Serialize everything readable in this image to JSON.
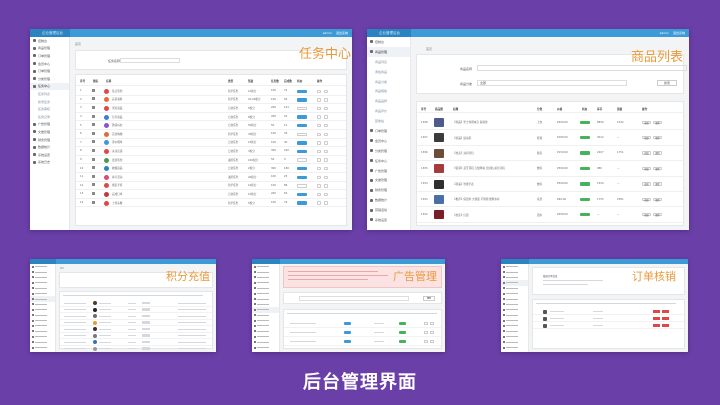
{
  "caption": "后台管理界面",
  "admin": {
    "logo": "企业管理后台",
    "user": "admin",
    "logout": "退出系统"
  },
  "colors": {
    "background": "#6a3fa8",
    "accent": "#3c9ad6",
    "overlay_title": "#e99a3a",
    "green": "#45b35c"
  },
  "task_center": {
    "title": "任务中心",
    "crumb": "首页",
    "filter_label": "任务名称",
    "sidebar": [
      "控制台",
      "商品管理",
      "订单管理",
      "会员中心",
      "订单管理",
      "分类管理",
      "任务中心",
      "任务列表",
      "新增任务",
      "任务审核",
      "任务记录",
      "广告管理",
      "文章管理",
      "财务管理",
      "数据统计",
      "系统设置",
      "系统日志"
    ],
    "columns": [
      "序号",
      "图标",
      "名称",
      "类型",
      "奖励",
      "任务数",
      "完成数",
      "状态",
      "操作"
    ],
    "rows": [
      {
        "id": "1",
        "name": "每日签到",
        "type": "新手任务",
        "reward": "10积分",
        "total": "100",
        "done": "72"
      },
      {
        "id": "2",
        "name": "完善资料",
        "type": "新手任务",
        "reward": "20.00积分",
        "total": "100",
        "done": "56"
      },
      {
        "id": "3",
        "name": "浏览商品",
        "type": "日常任务",
        "reward": "5积分",
        "total": "200",
        "done": "141"
      },
      {
        "id": "4",
        "name": "分享商品",
        "type": "日常任务",
        "reward": "8积分",
        "total": "200",
        "done": "91"
      },
      {
        "id": "5",
        "name": "邀请好友",
        "type": "日常任务",
        "reward": "50积分",
        "total": "50",
        "done": "12"
      },
      {
        "id": "6",
        "name": "首次购物",
        "type": "新手任务",
        "reward": "30积分",
        "total": "100",
        "done": "34"
      },
      {
        "id": "7",
        "name": "评价晒单",
        "type": "日常任务",
        "reward": "15积分",
        "total": "100",
        "done": "40"
      },
      {
        "id": "8",
        "name": "关注店铺",
        "type": "日常任务",
        "reward": "3积分",
        "total": "300",
        "done": "220"
      },
      {
        "id": "9",
        "name": "连续签到",
        "type": "进阶任务",
        "reward": "100积分",
        "total": "50",
        "done": "9"
      },
      {
        "id": "10",
        "name": "收藏商品",
        "type": "日常任务",
        "reward": "2积分",
        "total": "300",
        "done": "180"
      },
      {
        "id": "11",
        "name": "参与活动",
        "type": "进阶任务",
        "reward": "20积分",
        "total": "100",
        "done": "25"
      },
      {
        "id": "12",
        "name": "绑定手机",
        "type": "新手任务",
        "reward": "10积分",
        "total": "100",
        "done": "88"
      },
      {
        "id": "13",
        "name": "完成订单",
        "type": "日常任务",
        "reward": "10积分",
        "total": "200",
        "done": "63"
      },
      {
        "id": "14",
        "name": "上传头像",
        "type": "新手任务",
        "reward": "5积分",
        "total": "100",
        "done": "79"
      }
    ]
  },
  "product_list": {
    "title": "商品列表",
    "crumb": "首页",
    "filter_name": "商品名称",
    "filter_cat": "商品分类",
    "filter_cat_value": "全部",
    "search": "搜索",
    "sidebar": [
      "控制台",
      "商品管理",
      "商品列表",
      "添加商品",
      "商品分类",
      "商品规格",
      "商品品牌",
      "商品评价",
      "回收站",
      "订单管理",
      "会员中心",
      "分类管理",
      "任务中心",
      "广告管理",
      "文章管理",
      "财务管理",
      "数据统计",
      "营销活动",
      "系统设置"
    ],
    "columns": [
      "序号",
      "商品图",
      "标题",
      "分类",
      "价格",
      "状态",
      "库存",
      "销量",
      "操作"
    ],
    "rows": [
      {
        "id": "1398",
        "title": "【新品】男士休闲夹克 春秋款",
        "cat": "上衣",
        "price": "¥299.00",
        "stock": "8856",
        "sales": "1542"
      },
      {
        "id": "1397",
        "title": "【新品】运动鞋",
        "cat": "鞋靴",
        "price": "¥189.00",
        "stock": "3012",
        "sales": "—"
      },
      {
        "id": "1396",
        "title": "【热卖】双肩背包",
        "cat": "箱包",
        "price": "¥159.00",
        "stock": "2207",
        "sales": "1751"
      },
      {
        "id": "1395",
        "title": "【促销】蓝牙耳机 无线降噪 长续航 超长待机",
        "cat": "数码",
        "price": "¥399.00",
        "stock": "980",
        "sales": "—"
      },
      {
        "id": "1394",
        "title": "【新品】智能手表",
        "cat": "数码",
        "price": "¥599.00",
        "stock": "1520",
        "sales": "—"
      },
      {
        "id": "1393",
        "title": "【推荐】保温杯 大容量 不锈钢 便携水杯",
        "cat": "家居",
        "price": "¥69.00",
        "stock": "1755",
        "sales": "2381"
      },
      {
        "id": "1392",
        "title": "【热卖】红酒",
        "cat": "酒水",
        "price": "¥258.00",
        "stock": "—",
        "sales": "—"
      }
    ],
    "edit": "编辑",
    "del": "删除"
  },
  "points": {
    "title": "积分充值",
    "crumb": "首页"
  },
  "ads": {
    "title": "广告管理",
    "crumb": "首页",
    "search": "搜索"
  },
  "orders": {
    "title": "订单核销",
    "heading": "核销订单信息"
  }
}
